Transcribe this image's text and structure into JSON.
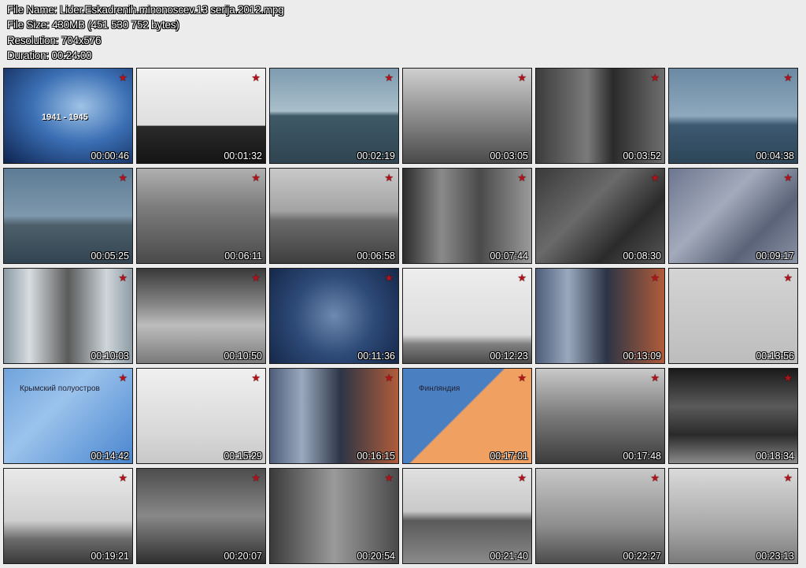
{
  "info": {
    "file_name": "File Name: Lider.Eskadrenih.minonoscev.13 serija.2012.mpg",
    "file_size": "File Size: 430MB (451 530 752 bytes)",
    "resolution": "Resolution: 704x576",
    "duration": "Duration: 00:24:00"
  },
  "colors": {
    "star": "#b3121a",
    "background": "#ececec"
  },
  "thumbnails": [
    {
      "time": "00:00:46",
      "scene": "s-blue",
      "overlay": "1941 - 1945"
    },
    {
      "time": "00:01:32",
      "scene": "s-white"
    },
    {
      "time": "00:02:19",
      "scene": "s-sea"
    },
    {
      "time": "00:03:05",
      "scene": "s-deck"
    },
    {
      "time": "00:03:52",
      "scene": "s-men"
    },
    {
      "time": "00:04:38",
      "scene": "s-ship"
    },
    {
      "time": "00:05:25",
      "scene": "s-ship2"
    },
    {
      "time": "00:06:11",
      "scene": "s-waves"
    },
    {
      "time": "00:06:58",
      "scene": "s-warship"
    },
    {
      "time": "00:07:44",
      "scene": "s-crew"
    },
    {
      "time": "00:08:30",
      "scene": "s-guns"
    },
    {
      "time": "00:09:17",
      "scene": "s-metal"
    },
    {
      "time": "00:10:03",
      "scene": "s-captain"
    },
    {
      "time": "00:10:50",
      "scene": "s-smoke"
    },
    {
      "time": "00:11:36",
      "scene": "s-mine"
    },
    {
      "time": "00:12:23",
      "scene": "s-pale"
    },
    {
      "time": "00:13:09",
      "scene": "s-host"
    },
    {
      "time": "00:13:56",
      "scene": "s-sky"
    },
    {
      "time": "00:14:42",
      "scene": "s-map",
      "map_label": "Крымский полуостров"
    },
    {
      "time": "00:15:29",
      "scene": "s-fog"
    },
    {
      "time": "00:16:15",
      "scene": "s-host"
    },
    {
      "time": "00:17:01",
      "scene": "s-map2",
      "map_label": "Финляндия"
    },
    {
      "time": "00:17:48",
      "scene": "s-sailors"
    },
    {
      "time": "00:18:34",
      "scene": "s-dark"
    },
    {
      "time": "00:19:21",
      "scene": "s-beach"
    },
    {
      "time": "00:20:07",
      "scene": "s-gray2"
    },
    {
      "time": "00:20:54",
      "scene": "s-crew2"
    },
    {
      "time": "00:21:40",
      "scene": "s-shore"
    },
    {
      "time": "00:22:27",
      "scene": "s-mast"
    },
    {
      "time": "00:23:13",
      "scene": "s-wake"
    }
  ]
}
